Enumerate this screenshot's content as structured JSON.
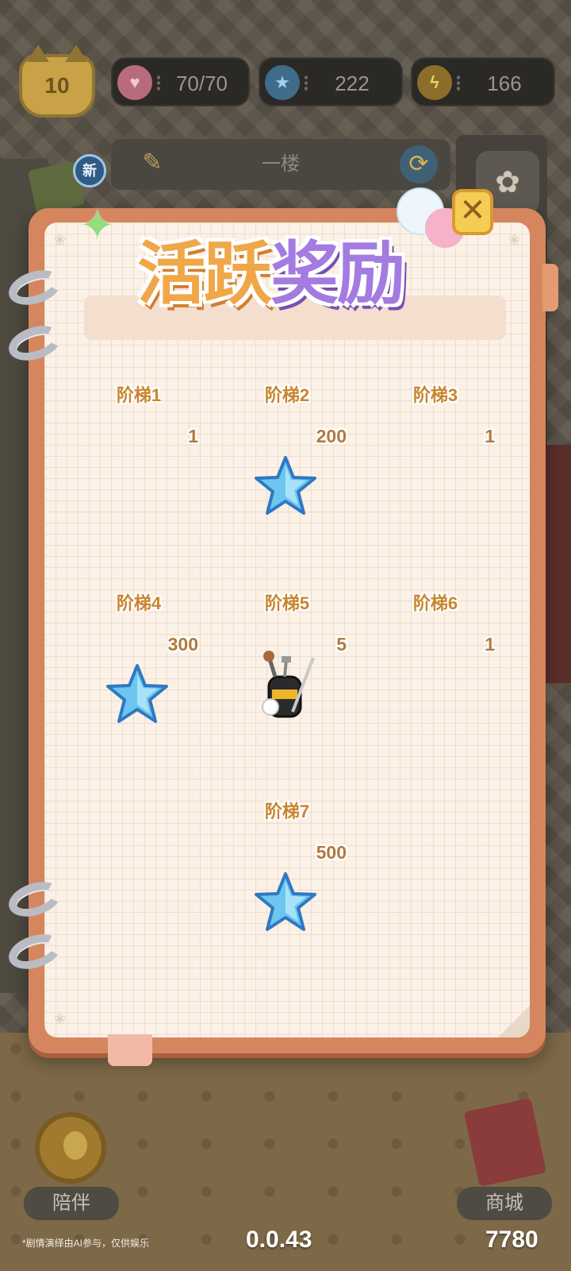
{
  "status_bar": {
    "level": "10",
    "hearts": "70/70",
    "stars": "222",
    "energy": "166"
  },
  "floor": {
    "name": "一楼",
    "new_badge": "新"
  },
  "modal": {
    "title_part1": "活跃",
    "title_part2": "奖励",
    "close_label": "✕",
    "tiers": [
      {
        "label": "阶梯1",
        "quantity": "1",
        "reward_icon": "none"
      },
      {
        "label": "阶梯2",
        "quantity": "200",
        "reward_icon": "blue-star"
      },
      {
        "label": "阶梯3",
        "quantity": "1",
        "reward_icon": "none"
      },
      {
        "label": "阶梯4",
        "quantity": "300",
        "reward_icon": "blue-star"
      },
      {
        "label": "阶梯5",
        "quantity": "5",
        "reward_icon": "golf-bag"
      },
      {
        "label": "阶梯6",
        "quantity": "1",
        "reward_icon": "none"
      },
      {
        "label": "阶梯7",
        "quantity": "500",
        "reward_icon": "blue-star"
      }
    ]
  },
  "bottom": {
    "companion_label": "陪伴",
    "shop_label": "商城",
    "disclaimer": "*剧情演绎由AI参与，仅供娱乐",
    "version": "0.0.43",
    "score": "7780"
  },
  "colors": {
    "accent_orange": "#f0a748",
    "accent_purple": "#a47be0",
    "tier_label": "#c9852e",
    "notebook_border": "#d6865f",
    "paper": "#fbf1e6"
  }
}
